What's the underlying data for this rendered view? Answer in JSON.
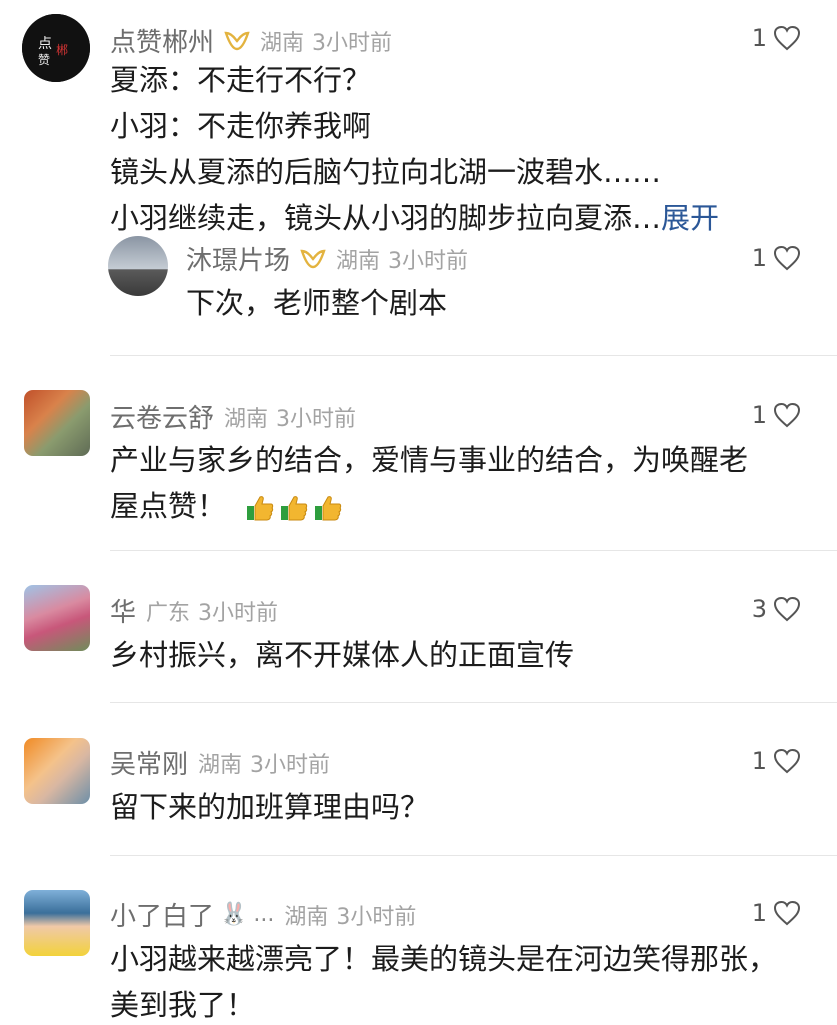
{
  "comments": [
    {
      "name": "点赞郴州",
      "location": "湖南",
      "time": "3小时前",
      "likes": "1",
      "badge": "creator-badge-icon",
      "lines": [
        "夏添：不走行不行？",
        "小羽：不走你养我啊",
        "镜头从夏添的后脑勺拉向北湖一波碧水……",
        "小羽继续走，镜头从小羽的脚步拉向夏添…"
      ],
      "expand": "展开",
      "reply": {
        "name": "沐璟片场",
        "location": "湖南",
        "time": "3小时前",
        "likes": "1",
        "badge": "creator-badge-icon",
        "lines": [
          "下次，老师整个剧本"
        ]
      }
    },
    {
      "name": "云卷云舒",
      "location": "湖南",
      "time": "3小时前",
      "likes": "1",
      "lines": [
        "产业与家乡的结合，爱情与事业的结合，为唤醒老",
        "屋点赞！"
      ],
      "emoji": "thumbs-up-icon"
    },
    {
      "name": "华",
      "location": "广东",
      "time": "3小时前",
      "likes": "3",
      "lines": [
        "乡村振兴，离不开媒体人的正面宣传"
      ]
    },
    {
      "name": "吴常刚",
      "location": "湖南",
      "time": "3小时前",
      "likes": "1",
      "lines": [
        "留下来的加班算理由吗？"
      ]
    },
    {
      "name": "小了白了",
      "location": "湖南",
      "time": "3小时前",
      "likes": "1",
      "ellipsis": "...",
      "lines": [
        "小羽越来越漂亮了！最美的镜头是在河边笑得那张，",
        "美到我了！"
      ]
    }
  ],
  "colors": {
    "accent": "#2b5797",
    "badge": "#e3b33f",
    "meta": "#a3a3a3"
  }
}
